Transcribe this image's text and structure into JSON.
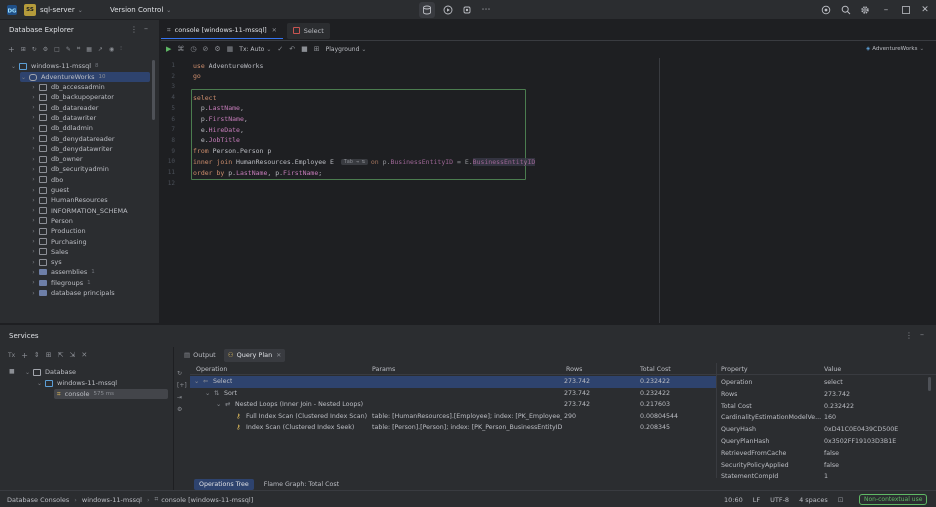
{
  "titlebar": {
    "project_badge": "SS",
    "project_name": "sql-server",
    "vcs_label": "Version Control"
  },
  "sidebar": {
    "title": "Database Explorer",
    "connection": {
      "label": "windows-11-mssql",
      "count": "8"
    },
    "database": {
      "label": "AdventureWorks",
      "count": "10"
    },
    "items": [
      {
        "label": "db_accessadmin",
        "icon": "schema"
      },
      {
        "label": "db_backupoperator",
        "icon": "schema"
      },
      {
        "label": "db_datareader",
        "icon": "schema"
      },
      {
        "label": "db_datawriter",
        "icon": "schema"
      },
      {
        "label": "db_ddladmin",
        "icon": "schema"
      },
      {
        "label": "db_denydatareader",
        "icon": "schema"
      },
      {
        "label": "db_denydatawriter",
        "icon": "schema"
      },
      {
        "label": "db_owner",
        "icon": "schema"
      },
      {
        "label": "db_securityadmin",
        "icon": "schema"
      },
      {
        "label": "dbo",
        "icon": "schema"
      },
      {
        "label": "guest",
        "icon": "schema"
      },
      {
        "label": "HumanResources",
        "icon": "schema"
      },
      {
        "label": "INFORMATION_SCHEMA",
        "icon": "schema"
      },
      {
        "label": "Person",
        "icon": "schema"
      },
      {
        "label": "Production",
        "icon": "schema"
      },
      {
        "label": "Purchasing",
        "icon": "schema"
      },
      {
        "label": "Sales",
        "icon": "schema"
      },
      {
        "label": "sys",
        "icon": "schema"
      },
      {
        "label": "assemblies",
        "icon": "folder",
        "count": "1"
      },
      {
        "label": "filegroups",
        "icon": "folder",
        "count": "1"
      },
      {
        "label": "database principals",
        "icon": "folder",
        "count": ""
      }
    ]
  },
  "editor": {
    "tabs": [
      {
        "label": "console [windows-11-mssql]",
        "active": true
      },
      {
        "label": "Select",
        "active": false
      }
    ],
    "tx_label": "Tx: Auto",
    "playground_label": "Playground",
    "context_label": "AdventureWorks",
    "lines": [
      {
        "n": "1",
        "tokens": [
          {
            "t": "use ",
            "c": "kw"
          },
          {
            "t": "AdventureWorks",
            "c": "plain"
          }
        ]
      },
      {
        "n": "2",
        "tokens": [
          {
            "t": "go",
            "c": "kw"
          }
        ]
      },
      {
        "n": "3",
        "tokens": []
      },
      {
        "n": "4",
        "tokens": [
          {
            "t": "select",
            "c": "kw"
          }
        ]
      },
      {
        "n": "5",
        "tokens": [
          {
            "t": "  p.",
            "c": "plain"
          },
          {
            "t": "LastName",
            "c": "fld"
          },
          {
            "t": ",",
            "c": "plain"
          }
        ]
      },
      {
        "n": "6",
        "tokens": [
          {
            "t": "  p.",
            "c": "plain"
          },
          {
            "t": "FirstName",
            "c": "fld"
          },
          {
            "t": ",",
            "c": "plain"
          }
        ]
      },
      {
        "n": "7",
        "tokens": [
          {
            "t": "  e.",
            "c": "plain"
          },
          {
            "t": "HireDate",
            "c": "fld"
          },
          {
            "t": ",",
            "c": "plain"
          }
        ]
      },
      {
        "n": "8",
        "tokens": [
          {
            "t": "  e.",
            "c": "plain"
          },
          {
            "t": "JobTitle",
            "c": "fld"
          }
        ]
      },
      {
        "n": "9",
        "tokens": [
          {
            "t": "from ",
            "c": "kw"
          },
          {
            "t": "Person.Person p",
            "c": "plain"
          }
        ]
      },
      {
        "n": "10",
        "tokens": [
          {
            "t": "inner join ",
            "c": "kw"
          },
          {
            "t": "HumanResources.Employee E ",
            "c": "plain"
          }
        ]
      },
      {
        "n": "11",
        "tokens": [
          {
            "t": "order by ",
            "c": "kw"
          },
          {
            "t": "p.",
            "c": "plain"
          },
          {
            "t": "LastName",
            "c": "fld"
          },
          {
            "t": ", p.",
            "c": "plain"
          },
          {
            "t": "FirstName",
            "c": "fld"
          },
          {
            "t": ";",
            "c": "plain"
          }
        ]
      },
      {
        "n": "12",
        "tokens": []
      }
    ],
    "inlay_hint": "Tab ⇥ ↹",
    "suggestion_tokens": [
      {
        "t": "on ",
        "c": "kw"
      },
      {
        "t": "p.",
        "c": "plain"
      },
      {
        "t": "BusinessEntityID",
        "c": "fld"
      },
      {
        "t": " = E.",
        "c": "plain"
      },
      {
        "t": "BusinessEntityID",
        "c": "fld"
      }
    ]
  },
  "services": {
    "title": "Services",
    "tree": {
      "root": "Database",
      "connection": "windows-11-mssql",
      "console": "console",
      "console_time": "575 ms"
    },
    "tabs": [
      {
        "label": "Output",
        "active": false
      },
      {
        "label": "Query Plan",
        "active": true
      }
    ],
    "plan_headers": [
      "Operation",
      "Params",
      "Rows",
      "Total Cost"
    ],
    "plan_rows": [
      {
        "operation": "Select",
        "params": "",
        "rows": "273.742",
        "cost": "0.232422",
        "indent": 0,
        "selected": true
      },
      {
        "operation": "Sort",
        "params": "",
        "rows": "273.742",
        "cost": "0.232422",
        "indent": 1,
        "selected": false
      },
      {
        "operation": "Nested Loops (Inner Join - Nested Loops)",
        "params": "",
        "rows": "273.742",
        "cost": "0.217603",
        "indent": 2,
        "selected": false
      },
      {
        "operation": "Full Index Scan (Clustered Index Scan)",
        "params": "table: [HumanResources].[Employee]; index: [PK_Employee_...",
        "rows": "290",
        "cost": "0.00804544",
        "indent": 3,
        "selected": false
      },
      {
        "operation": "Index Scan (Clustered Index Seek)",
        "params": "table: [Person].[Person]; index: [PK_Person_BusinessEntityID]; 1",
        "rows": "",
        "cost": "0.208345",
        "indent": 3,
        "selected": false
      }
    ],
    "prop_headers": [
      "Property",
      "Value"
    ],
    "properties": [
      {
        "k": "Operation",
        "v": "select"
      },
      {
        "k": "Rows",
        "v": "273.742"
      },
      {
        "k": "Total Cost",
        "v": "0.232422"
      },
      {
        "k": "CardinalityEstimationModelVe...",
        "v": "160"
      },
      {
        "k": "QueryHash",
        "v": "0xD41C0E0439CD500E"
      },
      {
        "k": "QueryPlanHash",
        "v": "0x3502FF19103D3B1E"
      },
      {
        "k": "RetrievedFromCache",
        "v": "false"
      },
      {
        "k": "SecurityPolicyApplied",
        "v": "false"
      },
      {
        "k": "StatementCompId",
        "v": "1"
      }
    ],
    "bottom_tabs": [
      {
        "label": "Operations Tree",
        "active": true
      },
      {
        "label": "Flame Graph: Total Cost",
        "active": false
      }
    ]
  },
  "statusbar": {
    "breadcrumb": [
      "Database Consoles",
      "windows-11-mssql",
      "console [windows-11-mssql]"
    ],
    "position": "10:60",
    "line_ending": "LF",
    "encoding": "UTF-8",
    "indent": "4 spaces",
    "badge": "Non-contextual use"
  },
  "colors": {
    "accent": "#3574f0",
    "selection": "#2e436e",
    "keyword": "#cf8e6d",
    "field": "#c77dbb",
    "badge_green": "#5fb865"
  }
}
